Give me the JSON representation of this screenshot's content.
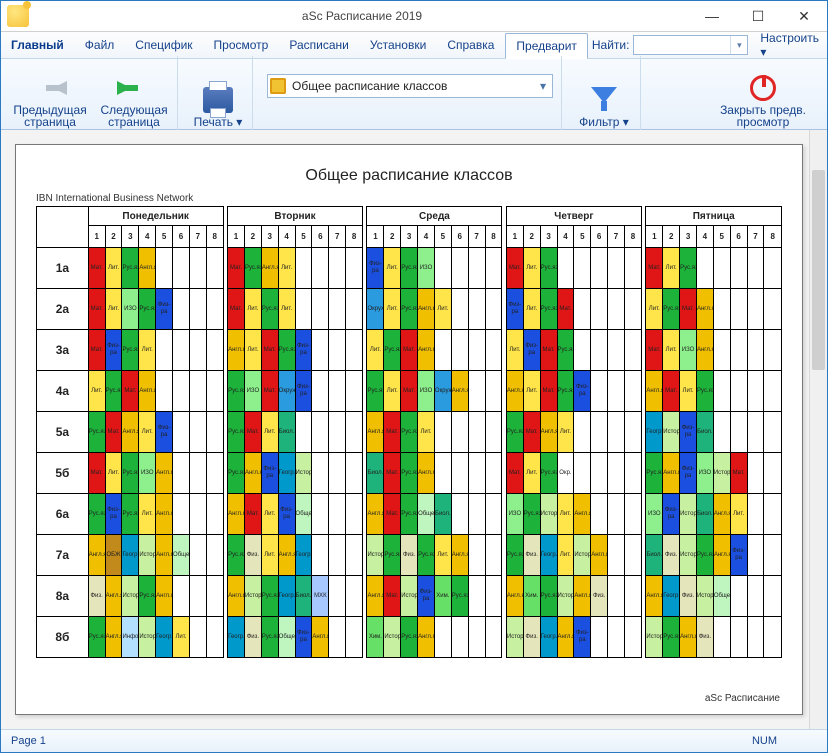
{
  "window": {
    "title": "aSc Расписание 2019"
  },
  "menu": {
    "tabs": [
      "Главный",
      "Файл",
      "Специфик",
      "Просмотр",
      "Расписани",
      "Установки",
      "Справка",
      "Предварит"
    ],
    "find_label": "Найти:",
    "configure": "Настроить ▾"
  },
  "ribbon": {
    "prev": "Предыдущая страница",
    "next": "Следующая страница",
    "print": "Печать ▾",
    "schedule_combo": "Общее расписание классов",
    "filter": "Фильтр ▾",
    "close_preview": "Закрыть предв. просмотр"
  },
  "document": {
    "title": "Общее расписание классов",
    "org": "IBN International Business Network",
    "days": [
      "Понедельник",
      "Вторник",
      "Среда",
      "Четверг",
      "Пятница"
    ],
    "periods": [
      "1",
      "2",
      "3",
      "4",
      "5",
      "6",
      "7",
      "8"
    ],
    "classes": [
      "1а",
      "2а",
      "3а",
      "4а",
      "5а",
      "5б",
      "6а",
      "7а",
      "8а",
      "8б"
    ],
    "footer": "aSc Расписание"
  },
  "chart_data": {
    "type": "table",
    "title": "Общее расписание классов",
    "row_labels": [
      "1а",
      "2а",
      "3а",
      "4а",
      "5а",
      "5б",
      "6а",
      "7а",
      "8а",
      "8б"
    ],
    "col_groups": [
      "Понедельник",
      "Вторник",
      "Среда",
      "Четверг",
      "Пятница"
    ],
    "periods_per_group": 8,
    "palette": {
      "Мат.": "#e01515",
      "Рус.яз.": "#1db33a",
      "Лит.": "#ffe54a",
      "Англ.яз.": "#f0c000",
      "Физ-ра": "#1b4fe0",
      "ИЗО": "#8df08d",
      "Окруж.": "#2b9be0",
      "Биол.": "#1db37a",
      "Истор.": "#c7f0a0",
      "Геогр.": "#0099cc",
      "Общест.": "#bff5bf",
      "Физ.": "#e5e5bb",
      "ОБЖ": "#c28a1a",
      "МХК": "#a6c8ff",
      "Информ.": "#b3e0ff",
      "Хим.": "#66e066"
    },
    "rows": [
      [
        [
          "Мат.",
          "Лит.",
          "Рус.яз.",
          "Англ.яз.",
          "",
          "",
          "",
          ""
        ],
        [
          "Мат.",
          "Рус.яз.",
          "Англ.яз.",
          "Лит.",
          "",
          "",
          "",
          ""
        ],
        [
          "Физ-ра",
          "Лит.",
          "Рус.яз.",
          "ИЗО",
          "",
          "",
          "",
          ""
        ],
        [
          "Мат.",
          "Лит.",
          "Рус.яз.",
          "",
          "",
          "",
          "",
          ""
        ],
        [
          "Мат.",
          "Лит.",
          "Рус.яз.",
          "",
          "",
          "",
          "",
          ""
        ]
      ],
      [
        [
          "Мат.",
          "Лит.",
          "ИЗО",
          "Рус.яз.",
          "Физ-ра",
          "",
          "",
          ""
        ],
        [
          "Мат.",
          "Лит.",
          "Рус.яз.",
          "Лит.",
          "",
          "",
          "",
          ""
        ],
        [
          "Окруж.",
          "Лит.",
          "Рус.яз.",
          "Англ.яз.",
          "Лит.",
          "",
          "",
          ""
        ],
        [
          "Физ-ра",
          "Лит.",
          "Рус.яз.",
          "Мат.",
          "",
          "",
          "",
          ""
        ],
        [
          "Лит.",
          "Рус.яз.",
          "Мат.",
          "Англ.яз.",
          "",
          "",
          "",
          ""
        ]
      ],
      [
        [
          "Мат.",
          "Физ-ра",
          "Рус.яз.",
          "Лит.",
          "",
          "",
          "",
          ""
        ],
        [
          "Англ.яз.",
          "Лит.",
          "Мат.",
          "Рус.яз.",
          "Физ-ра",
          "",
          "",
          ""
        ],
        [
          "Лит.",
          "Рус.яз.",
          "Мат.",
          "Англ.яз.",
          "",
          "",
          "",
          ""
        ],
        [
          "Лит.",
          "Физ-ра",
          "Мат.",
          "Рус.яз.",
          "",
          "",
          "",
          ""
        ],
        [
          "Мат.",
          "Лит.",
          "ИЗО",
          "Англ.яз.",
          "",
          "",
          "",
          ""
        ]
      ],
      [
        [
          "Лит.",
          "Рус.яз.",
          "Мат.",
          "Англ.яз.",
          "",
          "",
          "",
          ""
        ],
        [
          "Рус.яз.",
          "ИЗО",
          "Мат.",
          "Окруж.",
          "Физ-ра",
          "",
          "",
          ""
        ],
        [
          "Рус.яз.",
          "Лит.",
          "Мат.",
          "ИЗО",
          "Окруж.",
          "Англ.яз.",
          "",
          ""
        ],
        [
          "Англ.яз.",
          "Лит.",
          "Мат.",
          "Рус.яз.",
          "Физ-ра",
          "",
          "",
          ""
        ],
        [
          "Англ.яз.",
          "Мат.",
          "Лит.",
          "Рус.яз.",
          "",
          "",
          "",
          ""
        ]
      ],
      [
        [
          "Рус.яз.",
          "Мат.",
          "Англ.яз.",
          "Лит.",
          "Физ-ра",
          "",
          "",
          ""
        ],
        [
          "Рус.яз.",
          "Мат.",
          "Лит.",
          "Биол.",
          "",
          "",
          "",
          ""
        ],
        [
          "Англ.яз.",
          "Мат.",
          "Рус.яз.",
          "Лит.",
          "",
          "",
          "",
          ""
        ],
        [
          "Рус.яз.",
          "Мат.",
          "Англ.яз.",
          "Лит.",
          "",
          "",
          "",
          ""
        ],
        [
          "Геогр.",
          "Истор.",
          "Физ-ра",
          "Биол.",
          "",
          "",
          "",
          ""
        ]
      ],
      [
        [
          "Мат.",
          "Лит.",
          "Рус.яз.",
          "ИЗО",
          "Англ.яз.",
          "",
          "",
          ""
        ],
        [
          "Рус.яз.",
          "Англ.яз.",
          "Физ-ра",
          "Геогр.",
          "Истор.",
          "",
          "",
          ""
        ],
        [
          "Биол.",
          "Мат.",
          "Рус.яз.",
          "Англ.яз.",
          "",
          "",
          "",
          ""
        ],
        [
          "Мат.",
          "Лит.",
          "Рус.яз.",
          "Окр.",
          "",
          "",
          "",
          ""
        ],
        [
          "Рус.яз.",
          "Англ.яз.",
          "Физ-ра",
          "ИЗО",
          "Истор.",
          "Мат.",
          "",
          ""
        ]
      ],
      [
        [
          "Рус.яз.",
          "Физ-ра",
          "Рус.яз.",
          "Лит.",
          "Англ.яз.",
          "",
          "",
          ""
        ],
        [
          "Англ.яз.",
          "Мат.",
          "Лит.",
          "Физ-ра",
          "Общест.",
          "",
          "",
          ""
        ],
        [
          "Англ.яз.",
          "Мат.",
          "Рус.яз.",
          "Общест.",
          "Биол.",
          "",
          "",
          ""
        ],
        [
          "ИЗО",
          "Рус.яз.",
          "Истор.",
          "Лит.",
          "Англ.яз.",
          "",
          "",
          ""
        ],
        [
          "ИЗО",
          "Физ-ра",
          "Истор.",
          "Биол.",
          "Англ.яз.",
          "Лит.",
          "",
          ""
        ]
      ],
      [
        [
          "Англ.яз.",
          "ОБЖ",
          "Геогр.",
          "Истор.",
          "Англ.яз.",
          "Общест.",
          "",
          ""
        ],
        [
          "Рус.яз.",
          "Физ.",
          "Лит.",
          "Англ.яз.",
          "Геогр.",
          "",
          "",
          ""
        ],
        [
          "Истор.",
          "Рус.яз.",
          "Физ.",
          "Рус.яз.",
          "Лит.",
          "Англ.яз.",
          "",
          ""
        ],
        [
          "Рус.яз.",
          "Физ.",
          "Геогр.",
          "Лит.",
          "Истор.",
          "Англ.яз.",
          "",
          ""
        ],
        [
          "Биол.",
          "Физ.",
          "Истор.",
          "Рус.яз.",
          "Англ.яз.",
          "Физ-ра",
          "",
          ""
        ]
      ],
      [
        [
          "Физ.",
          "Англ.яз.",
          "Истор.",
          "Рус.яз.",
          "Англ.яз.",
          "",
          "",
          ""
        ],
        [
          "Англ.яз.",
          "Истор.",
          "Рус.яз.",
          "Геогр.",
          "Биол.",
          "МХК",
          "",
          ""
        ],
        [
          "Англ.яз.",
          "Мат.",
          "Истор.",
          "Физ-ра",
          "Хим.",
          "Рус.яз.",
          "",
          ""
        ],
        [
          "Англ.яз.",
          "Хим.",
          "Рус.яз.",
          "Истор.",
          "Англ.яз.",
          "Физ.",
          "",
          ""
        ],
        [
          "Англ.яз.",
          "Геогр.",
          "Физ.",
          "Истор.",
          "Общест.",
          "",
          "",
          ""
        ]
      ],
      [
        [
          "Рус.яз.",
          "Англ.яз.",
          "Информ.",
          "Истор.",
          "Геогр.",
          "Лит.",
          "",
          ""
        ],
        [
          "Геогр.",
          "Физ.",
          "Рус.яз.",
          "Общест.",
          "Физ-ра",
          "Англ.яз.",
          "",
          ""
        ],
        [
          "Хим.",
          "Истор.",
          "Рус.яз.",
          "Англ.яз.",
          "",
          "",
          "",
          ""
        ],
        [
          "Истор.",
          "Физ.",
          "Геогр.",
          "Англ.яз.",
          "Физ-ра",
          "",
          "",
          ""
        ],
        [
          "Истор.",
          "Рус.яз.",
          "Англ.яз.",
          "Физ.",
          "",
          "",
          "",
          ""
        ]
      ]
    ]
  },
  "status": {
    "page": "Page 1",
    "num": "NUM"
  }
}
